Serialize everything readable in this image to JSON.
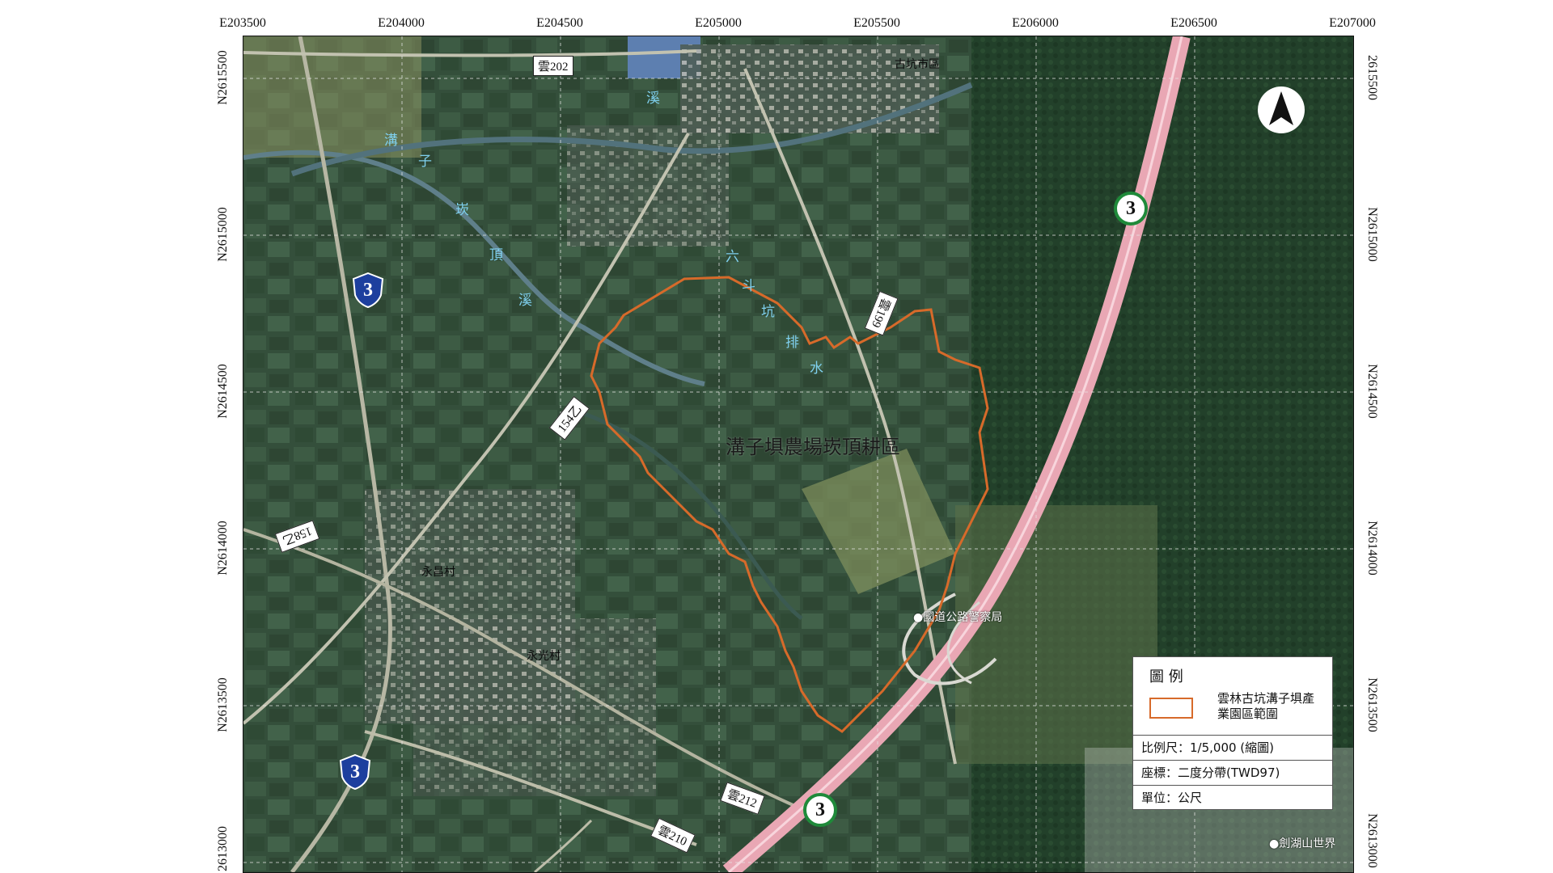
{
  "map": {
    "coords_top": [
      "E203500",
      "E204000",
      "E204500",
      "E205000",
      "E205500",
      "E206000",
      "E206500",
      "E207000"
    ],
    "coords_left": [
      "N2615500",
      "N2615000",
      "N2614500",
      "N2614000",
      "N2613500",
      "2613000"
    ],
    "coords_right": [
      "2615500",
      "N2615000",
      "N2614500",
      "N2614000",
      "N2613500",
      "N2613000"
    ],
    "place_labels": {
      "gukeng_city": "古坑市區",
      "yongchang": "永昌村",
      "yongguang": "永光村",
      "highway_police": "●國道公路警察局",
      "janfusun": "●劍湖山世界"
    },
    "area_label": "溝子埧農場崁頂耕區",
    "streams": {
      "kanding": [
        "溝",
        "子",
        "崁",
        "頂",
        "溪"
      ],
      "ditch_xi": "溪",
      "liudoukeng": [
        "六",
        "斗",
        "坑",
        "排",
        "水"
      ]
    },
    "road_badges": {
      "yun202": "雲202",
      "r154yi": "154乙",
      "r158yi": "158乙",
      "yun199": "雲199",
      "yun212": "雲212",
      "yun210": "雲210"
    },
    "shields": {
      "provincial_3_north": "3",
      "provincial_3_south": "3",
      "freeway_3_north": "3",
      "freeway_3_south": "3"
    },
    "colors": {
      "boundary": "#d76a2a",
      "freeway": "#e9a7b4",
      "stream_text": "#7fd0ee",
      "provincial_shield": "#1d3f9e",
      "freeway_shield": "#1f8a3a"
    },
    "legend": {
      "title": "圖 例",
      "item": "雲林古坑溝子埧產業園區範圍",
      "scale": "比例尺：1/5,000 (縮圖)",
      "coords": "座標：二度分帶(TWD97)",
      "unit": "單位：公尺"
    },
    "north_icon": "north-arrow-icon"
  }
}
